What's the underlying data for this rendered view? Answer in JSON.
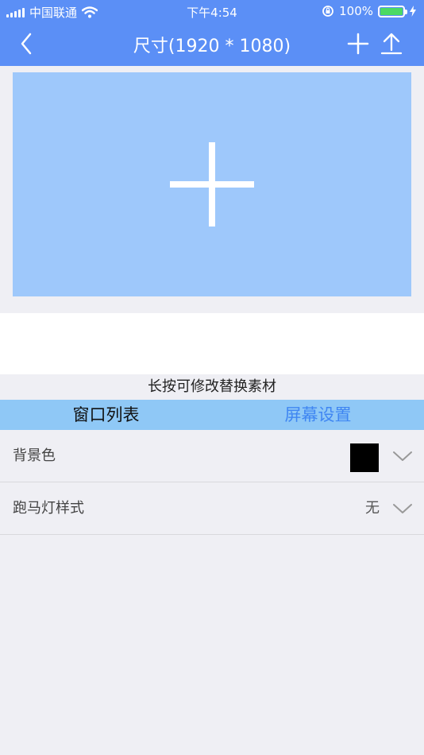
{
  "status_bar": {
    "carrier": "中国联通",
    "time": "下午4:54",
    "battery_percent": "100%",
    "battery_level": 1.0,
    "battery_color": "#4cd964"
  },
  "nav": {
    "title": "尺寸(1920 * 1080)",
    "bg_color": "#5b8ff6"
  },
  "preview": {
    "bg_color": "#9ec8fb"
  },
  "hint_text": "长按可修改替换素材",
  "tabs": [
    {
      "label": "窗口列表"
    },
    {
      "label": "屏幕设置"
    }
  ],
  "settings": [
    {
      "label": "背景色",
      "swatch_color": "#000000"
    },
    {
      "label": "跑马灯样式",
      "value": "无"
    }
  ]
}
